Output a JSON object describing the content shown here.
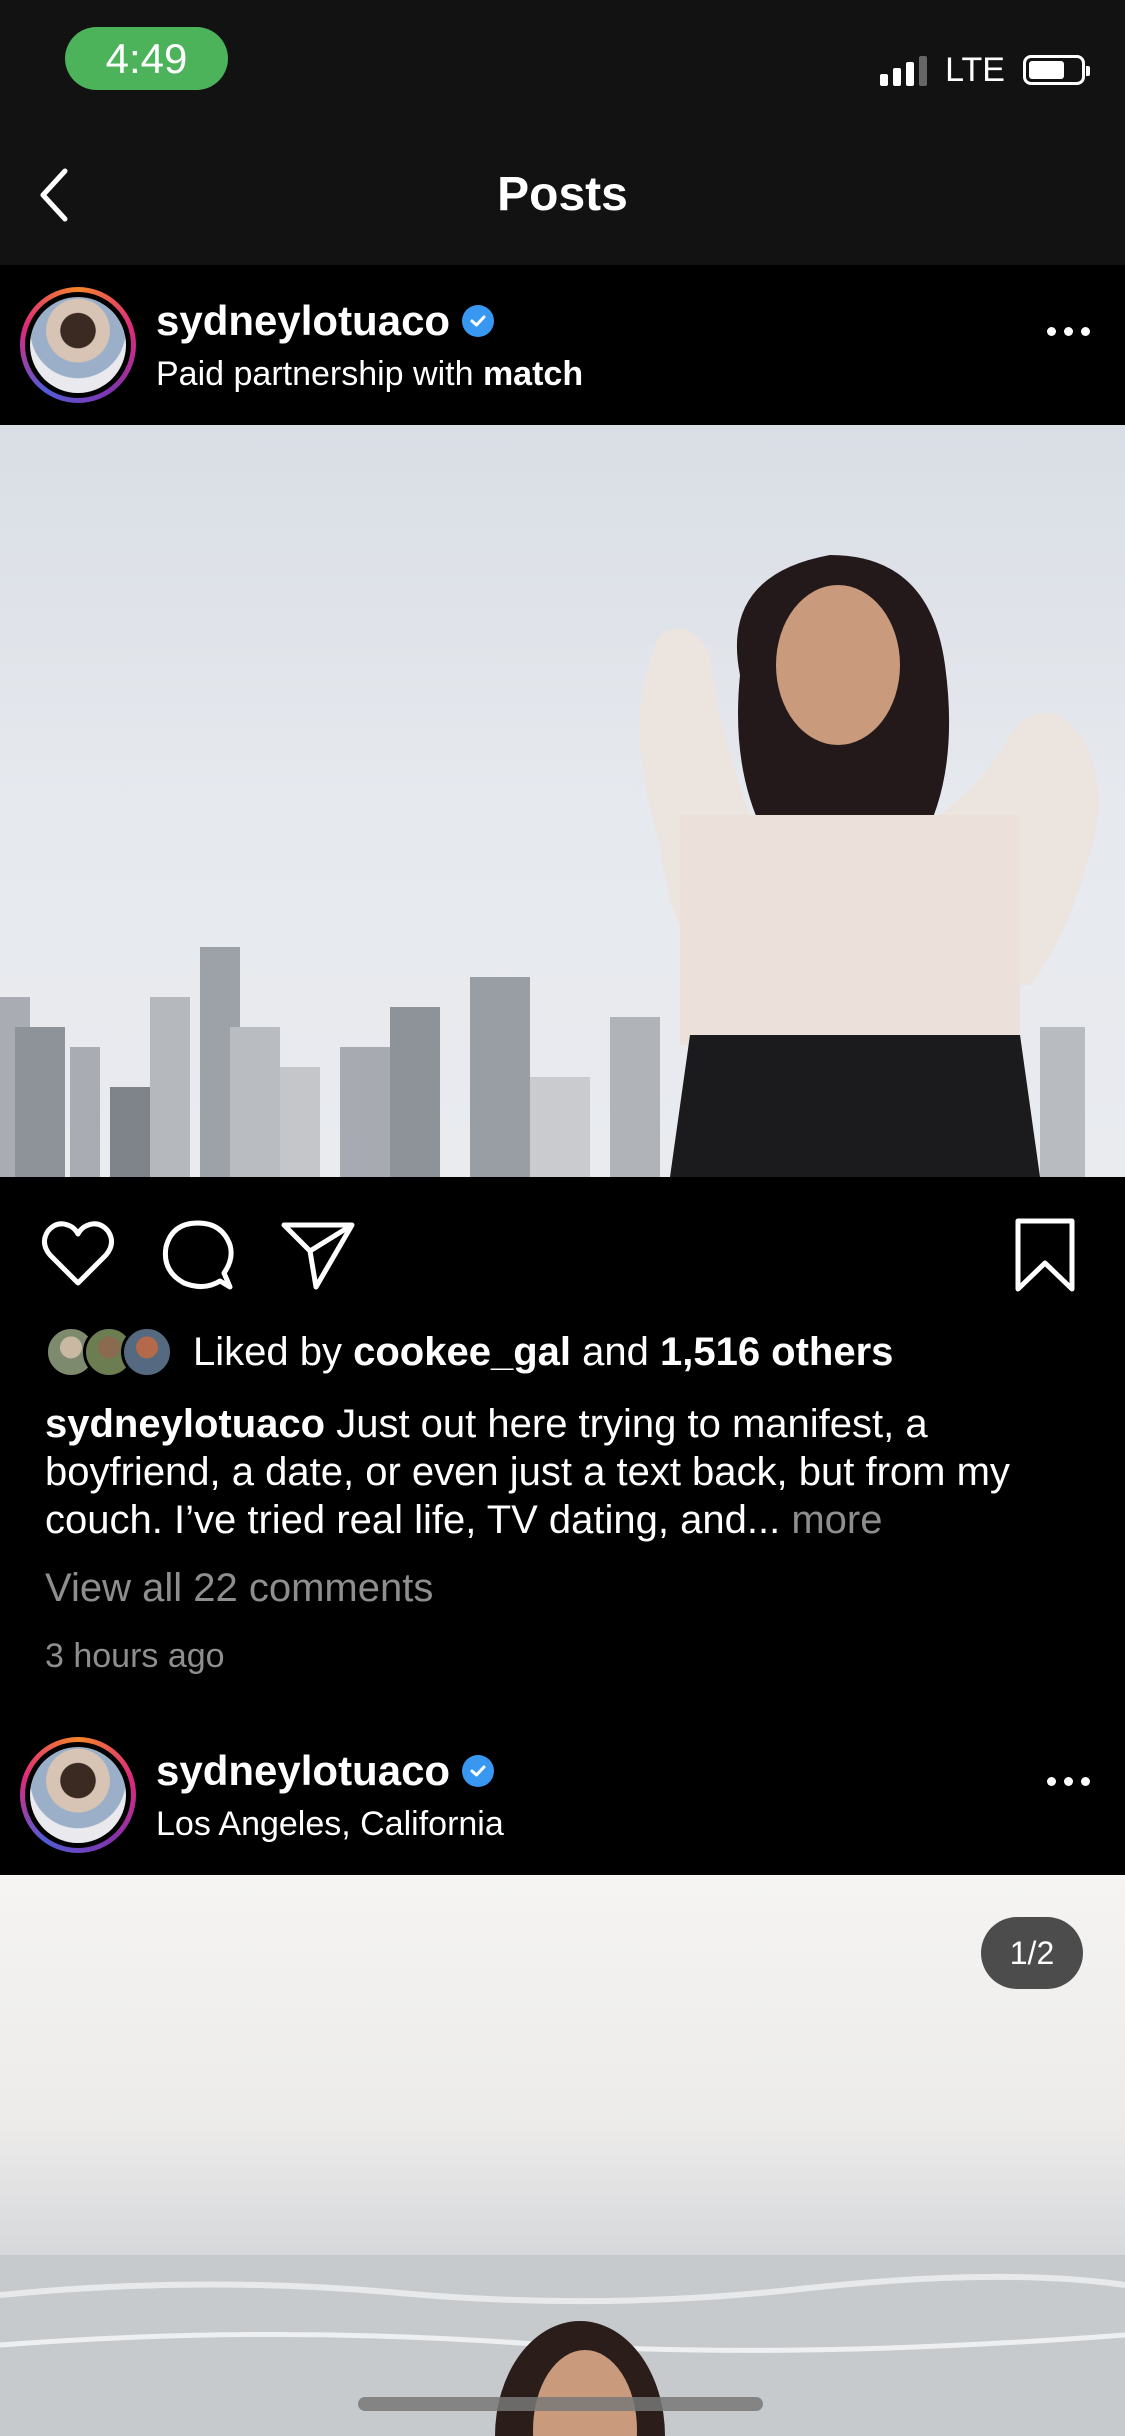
{
  "status_bar": {
    "time": "4:49",
    "network": "LTE"
  },
  "nav": {
    "title": "Posts"
  },
  "posts": [
    {
      "username": "sydneylotuaco",
      "subline_prefix": "Paid partnership with ",
      "subline_bold": "match",
      "liked_by_prefix": "Liked by ",
      "liked_by_user": "cookee_gal",
      "liked_by_mid": " and ",
      "liked_by_count": "1,516 others",
      "caption_user": "sydneylotuaco",
      "caption_text": " Just out here trying to manifest, a boyfriend, a date, or even just a text back, but from my couch. I’ve tried real life, TV dating, and...",
      "caption_more": " more",
      "view_comments": "View all 22 comments",
      "time_ago": "3 hours ago"
    },
    {
      "username": "sydneylotuaco",
      "location": "Los Angeles, California",
      "page_indicator": "1/2"
    }
  ],
  "icons": {
    "back": "chevron-left-icon",
    "verified": "verified-badge-icon",
    "more": "more-horizontal-icon",
    "like": "heart-icon",
    "comment": "comment-bubble-icon",
    "share": "paper-plane-icon",
    "save": "bookmark-icon"
  },
  "colors": {
    "time_pill": "#4cb35a",
    "verified": "#3897f0",
    "secondary_text": "#8e8e8e"
  }
}
